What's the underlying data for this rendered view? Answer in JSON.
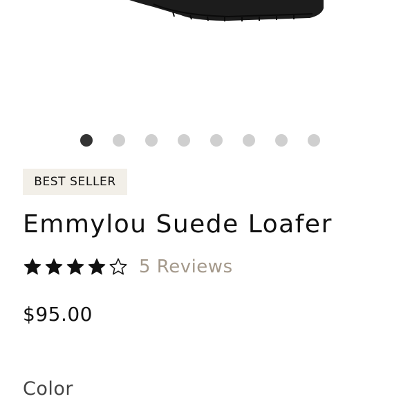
{
  "product": {
    "badge": "BEST SELLER",
    "name": "Emmylou Suede Loafer",
    "rating": 4,
    "rating_max": 5,
    "reviews_label": "5 Reviews",
    "price": "$95.00",
    "color_label": "Color"
  },
  "carousel": {
    "total_slides": 8,
    "active_index": 0
  },
  "colors": {
    "badge_bg": "#f2efe8",
    "reviews_link": "#a4998b",
    "dot_active": "#333333",
    "dot_inactive": "#cfcfcf"
  }
}
